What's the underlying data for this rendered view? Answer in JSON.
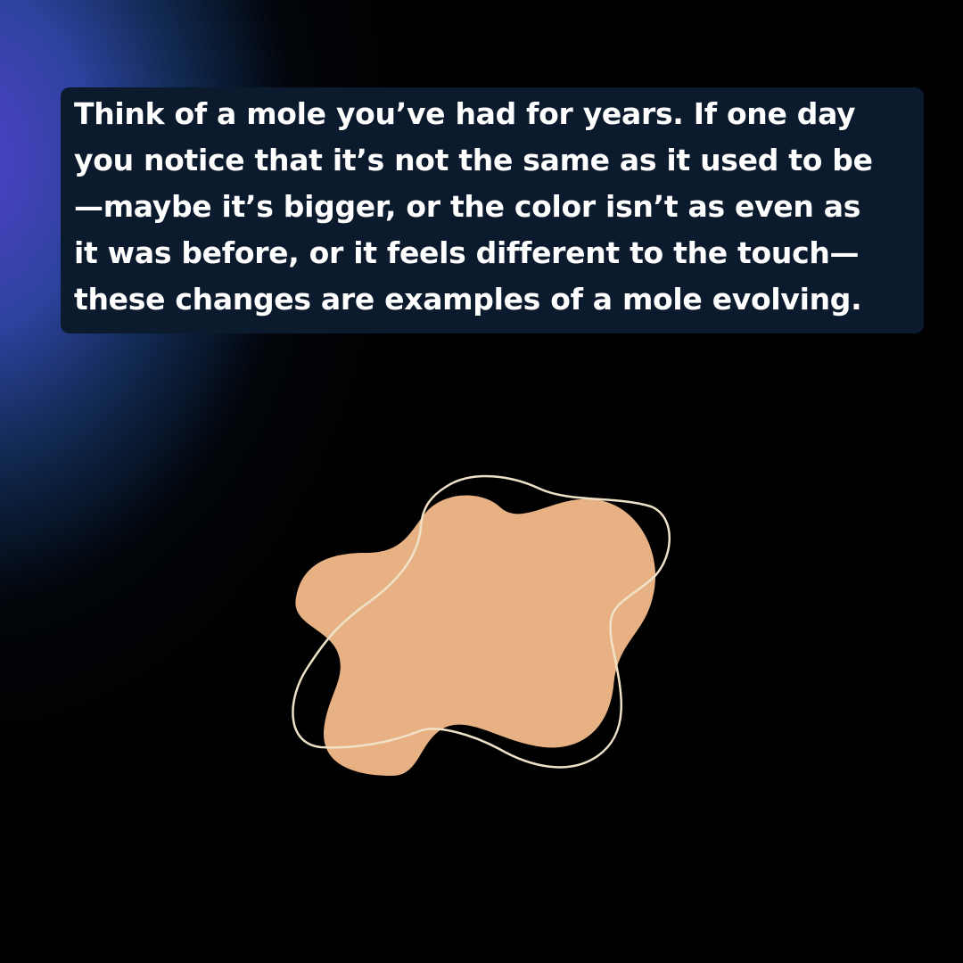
{
  "caption": {
    "lines": [
      "Think of a mole you’ve had for years. If one day",
      "you notice that it’s not the same as it used to be",
      "—maybe it’s bigger, or the color isn’t as even as",
      "it was before, or it feels different to the touch—",
      "these changes are examples of a mole evolving."
    ]
  },
  "illustration": {
    "mole_color": "#e8b184",
    "outline_color": "#efe2c8"
  },
  "colors": {
    "background": "#000000",
    "caption_box": "#0c1a2e",
    "caption_text": "#ffffff",
    "glow_violet": "#5646d6",
    "glow_blue": "#265cb4"
  }
}
